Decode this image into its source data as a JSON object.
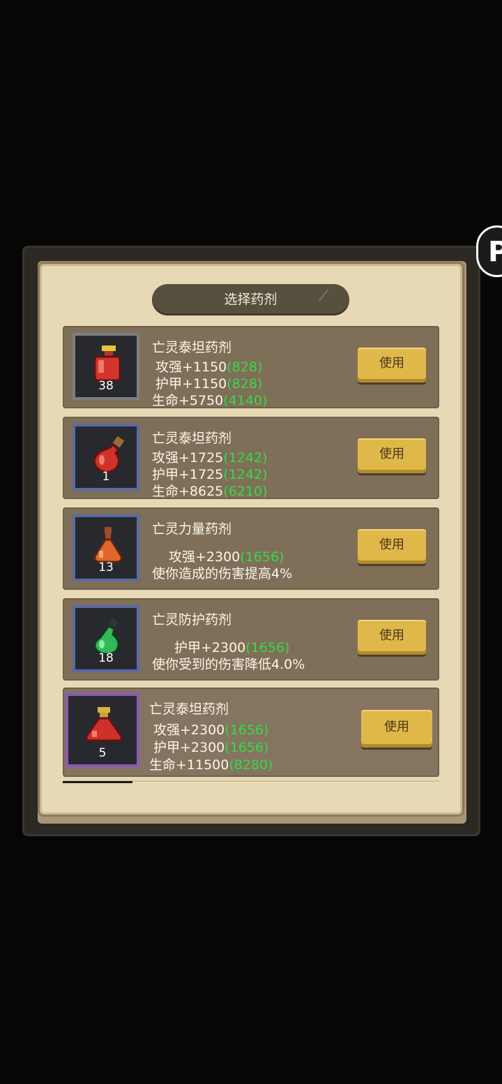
{
  "dialog": {
    "title": "选择药剂"
  },
  "side_button": {
    "glyph": "P"
  },
  "potions": [
    {
      "name": "亡灵泰坦药剂",
      "count": "38",
      "icon": "red-square-flask-icon",
      "lines": [
        {
          "text": "攻强+1150",
          "bonus": "(828)"
        },
        {
          "text": "护甲+1150",
          "bonus": "(828)"
        },
        {
          "text": "生命+5750",
          "bonus": "(4140)"
        }
      ],
      "button": "使用"
    },
    {
      "name": "亡灵泰坦药剂",
      "count": "1",
      "icon": "red-round-flask-icon",
      "lines": [
        {
          "text": "攻强+1725",
          "bonus": "(1242)"
        },
        {
          "text": "护甲+1725",
          "bonus": "(1242)"
        },
        {
          "text": "生命+8625",
          "bonus": "(6210)"
        }
      ],
      "button": "使用"
    },
    {
      "name": "亡灵力量药剂",
      "count": "13",
      "icon": "orange-flask-icon",
      "lines": [
        {
          "text": "攻强+2300",
          "bonus": "(1656)"
        },
        {
          "text": "使你造成的伤害提高4%",
          "bonus": ""
        }
      ],
      "button": "使用"
    },
    {
      "name": "亡灵防护药剂",
      "count": "18",
      "icon": "green-flask-icon",
      "lines": [
        {
          "text": "护甲+2300",
          "bonus": "(1656)"
        },
        {
          "text": "使你受到的伤害降低4.0%",
          "bonus": ""
        }
      ],
      "button": "使用"
    },
    {
      "name": "亡灵泰坦药剂",
      "count": "5",
      "icon": "red-pyramid-flask-icon",
      "lines": [
        {
          "text": "攻强+2300",
          "bonus": "(1656)"
        },
        {
          "text": "护甲+2300",
          "bonus": "(1656)"
        },
        {
          "text": "生命+11500",
          "bonus": "(8280)"
        }
      ],
      "button": "使用"
    }
  ],
  "colors": {
    "bonus_green": "#37d84a",
    "button_gold": "#e0b84a",
    "row_brown": "#7f6f58",
    "parchment": "#e7d9b5"
  }
}
